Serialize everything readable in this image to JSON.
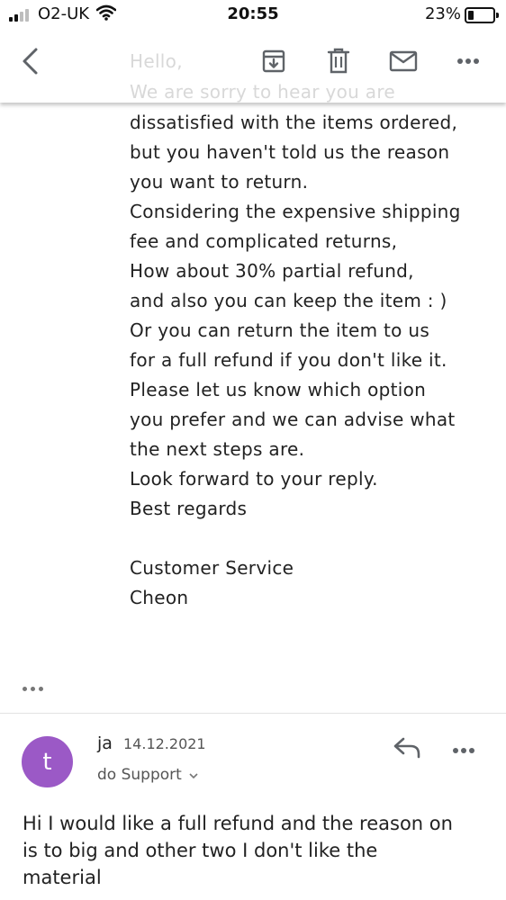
{
  "status_bar": {
    "carrier": "O2-UK",
    "time": "20:55",
    "battery_percent": "23%"
  },
  "toolbar": {
    "back": "back-icon",
    "archive": "archive-icon",
    "delete": "trash-icon",
    "mark_unread": "mail-icon",
    "more": "more-icon",
    "faded_line_1": "Hello,",
    "faded_line_2": "We are sorry to hear you are"
  },
  "message": {
    "lines": [
      "dissatisfied with the items ordered,",
      "but you haven't told us the reason",
      "you want to return.",
      "Considering the expensive shipping",
      "fee and complicated returns,",
      "How about 30% partial refund,",
      "and also you can keep the item : )",
      "Or you can return the item to us",
      "for a full refund if you don't like it.",
      "Please let us know which option",
      "you prefer and we can advise what",
      "the next steps are.",
      "Look forward to your reply.",
      "Best regards",
      "",
      "Customer Service",
      "Cheon"
    ]
  },
  "reply": {
    "avatar_letter": "t",
    "avatar_color": "#9b59c6",
    "sender": "ja",
    "date": "14.12.2021",
    "recipient": "do Support",
    "body_lines": [
      "Hi I would like a full refund and the reason on",
      "is to big and other two I don't like the",
      "material"
    ]
  }
}
